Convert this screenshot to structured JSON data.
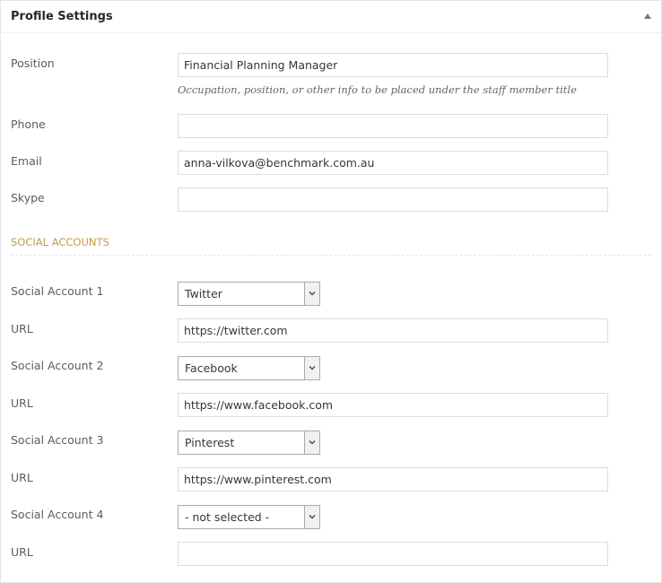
{
  "panel": {
    "title": "Profile Settings",
    "toggle_icon": "arrow-up-icon"
  },
  "fields": {
    "position": {
      "label": "Position",
      "value": "Financial Planning Manager",
      "hint": "Occupation, position, or other info to be placed under the staff member title"
    },
    "phone": {
      "label": "Phone",
      "value": ""
    },
    "email": {
      "label": "Email",
      "value": "anna-vilkova@benchmark.com.au"
    },
    "skype": {
      "label": "Skype",
      "value": ""
    }
  },
  "social": {
    "heading": "SOCIAL ACCOUNTS",
    "heading_color": "#c59a4a",
    "accounts": [
      {
        "label": "Social Account 1",
        "selected": "Twitter",
        "url_label": "URL",
        "url": "https://twitter.com"
      },
      {
        "label": "Social Account 2",
        "selected": "Facebook",
        "url_label": "URL",
        "url": "https://www.facebook.com"
      },
      {
        "label": "Social Account 3",
        "selected": "Pinterest",
        "url_label": "URL",
        "url": "https://www.pinterest.com"
      },
      {
        "label": "Social Account 4",
        "selected": "- not selected -",
        "url_label": "URL",
        "url": ""
      }
    ]
  }
}
